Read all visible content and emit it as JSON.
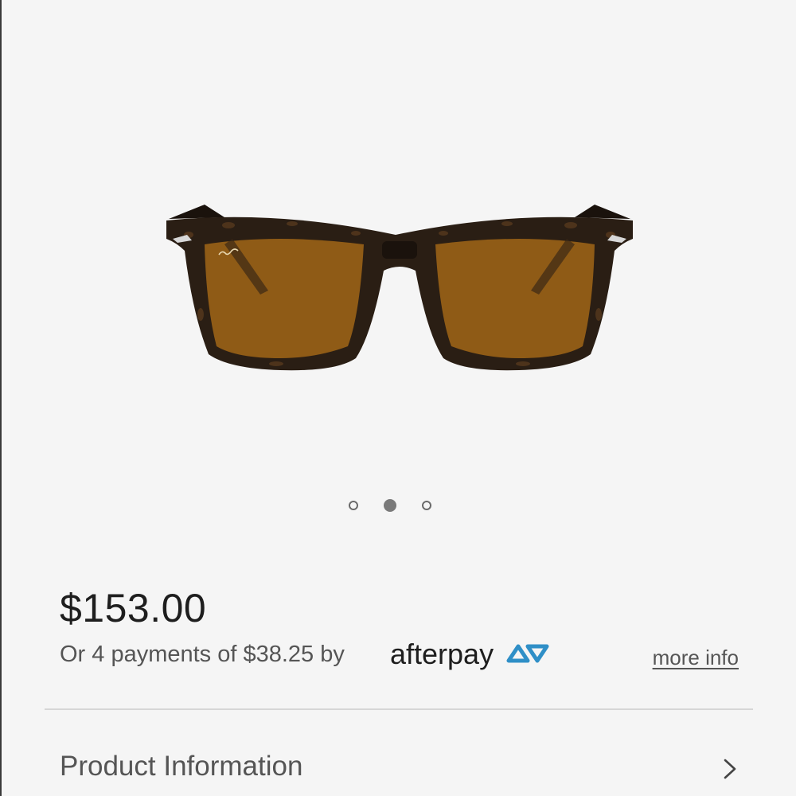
{
  "product": {
    "image_alt": "Ray-Ban folding wayfarer sunglasses, tortoise frame with brown lenses",
    "frame_logo": "Ray-Ban"
  },
  "carousel": {
    "total_slides": 3,
    "active_index": 1
  },
  "pricing": {
    "price": "$153.00",
    "installments_text": "Or  4 payments of $38.25 by",
    "provider_logo_text": "afterpay",
    "more_info_label": "more info"
  },
  "sections": {
    "product_information_label": "Product Information"
  },
  "colors": {
    "background": "#f5f5f5",
    "frame": "#2a1e14",
    "lens": "#8f5b16",
    "text_primary": "#1e1e1e",
    "text_secondary": "#555555",
    "afterpay_accent": "#2f8fc7"
  },
  "icons": {
    "chevron": "chevron-right-icon",
    "afterpay_mark": "afterpay-arrows-icon"
  }
}
